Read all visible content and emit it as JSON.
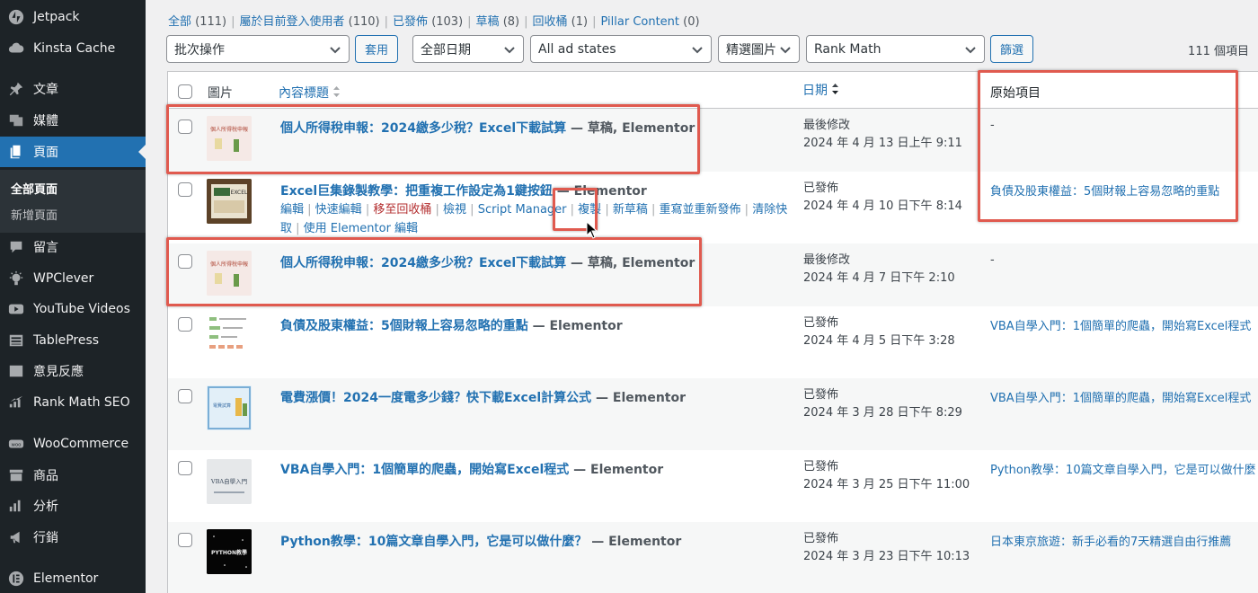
{
  "sidebar": {
    "items": [
      {
        "label": "Jetpack",
        "icon": "jetpack-icon"
      },
      {
        "label": "Kinsta Cache",
        "icon": "cloud-icon"
      },
      {
        "label": "文章",
        "icon": "pin-icon"
      },
      {
        "label": "媒體",
        "icon": "media-icon"
      },
      {
        "label": "頁面",
        "icon": "page-icon",
        "active": true
      },
      {
        "label": "留言",
        "icon": "comment-icon"
      },
      {
        "label": "WPClever",
        "icon": "bulb-icon"
      },
      {
        "label": "YouTube Videos",
        "icon": "youtube-icon"
      },
      {
        "label": "TablePress",
        "icon": "table-icon"
      },
      {
        "label": "意見反應",
        "icon": "feedback-icon"
      },
      {
        "label": "Rank Math SEO",
        "icon": "chart-icon"
      },
      {
        "label": "WooCommerce",
        "icon": "woo-icon"
      },
      {
        "label": "商品",
        "icon": "archive-icon"
      },
      {
        "label": "分析",
        "icon": "bar-chart-icon"
      },
      {
        "label": "行銷",
        "icon": "megaphone-icon"
      },
      {
        "label": "Elementor",
        "icon": "elementor-icon"
      }
    ],
    "submenu": [
      "全部頁面",
      "新增頁面"
    ]
  },
  "filters": {
    "views": [
      {
        "label": "全部",
        "count": "(111)"
      },
      {
        "label": "屬於目前登入使用者",
        "count": "(110)"
      },
      {
        "label": "已發佈",
        "count": "(103)"
      },
      {
        "label": "草稿",
        "count": "(8)"
      },
      {
        "label": "回收桶",
        "count": "(1)"
      },
      {
        "label": "Pillar Content",
        "count": "(0)"
      }
    ],
    "bulk_action": "批次操作",
    "apply": "套用",
    "all_dates": "全部日期",
    "ad_states": "All ad states",
    "featured_image": "精選圖片",
    "rank_math": "Rank Math",
    "filter": "篩選",
    "items_count": "111 個項目"
  },
  "table": {
    "columns": {
      "image": "圖片",
      "title": "內容標題",
      "date": "日期",
      "original": "原始項目"
    },
    "rows": [
      {
        "title": "個人所得稅申報：2024繳多少稅？Excel下載試算",
        "state": " — 草稿, Elementor",
        "date_status": "最後修改",
        "date": "2024 年 4 月 13 日上午 9:11",
        "original": "-"
      },
      {
        "title": "Excel巨集錄製教學：把重複工作設定為1鍵按鈕",
        "state": " — Elementor",
        "date_status": "已發佈",
        "date": "2024 年 4 月 10 日下午 8:14",
        "original": "負債及股東權益：5個財報上容易忽略的重點",
        "actions": [
          "編輯",
          "快速編輯",
          "移至回收桶",
          "檢視",
          "Script Manager",
          "複製",
          "新草稿",
          "重寫並重新發佈",
          "清除快取",
          "使用 Elementor 編輯"
        ]
      },
      {
        "title": "個人所得稅申報：2024繳多少稅？Excel下載試算",
        "state": " — 草稿, Elementor",
        "date_status": "最後修改",
        "date": "2024 年 4 月 7 日下午 2:10",
        "original": "-"
      },
      {
        "title": "負債及股東權益：5個財報上容易忽略的重點",
        "state": " — Elementor",
        "date_status": "已發佈",
        "date": "2024 年 4 月 5 日下午 3:28",
        "original": "VBA自學入門：1個簡單的爬蟲，開始寫Excel程式"
      },
      {
        "title": "電費漲價！2024一度電多少錢？快下載Excel計算公式",
        "state": " — Elementor",
        "date_status": "已發佈",
        "date": "2024 年 3 月 28 日下午 8:29",
        "original": "VBA自學入門：1個簡單的爬蟲，開始寫Excel程式"
      },
      {
        "title": "VBA自學入門：1個簡單的爬蟲，開始寫Excel程式",
        "state": " — Elementor",
        "date_status": "已發佈",
        "date": "2024 年 3 月 25 日下午 11:00",
        "original": "Python教學：10篇文章自學入門，它是可以做什麼"
      },
      {
        "title": "Python教學：10篇文章自學入門，它是可以做什麼？",
        "state": " — Elementor",
        "date_status": "已發佈",
        "date": "2024 年 3 月 23 日下午 10:13",
        "original": "日本東京旅遊：新手必看的7天精選自由行推薦"
      }
    ],
    "thumbs": {
      "tax": "個人所得稅申報",
      "excel_label": "EXCEL",
      "vba": "VBA自學入門",
      "python": "PYTHON教學",
      "elec": "電費試算"
    }
  },
  "colors": {
    "accent": "#2271b1",
    "highlight": "#e05a4f",
    "sidebar": "#1d2327"
  }
}
